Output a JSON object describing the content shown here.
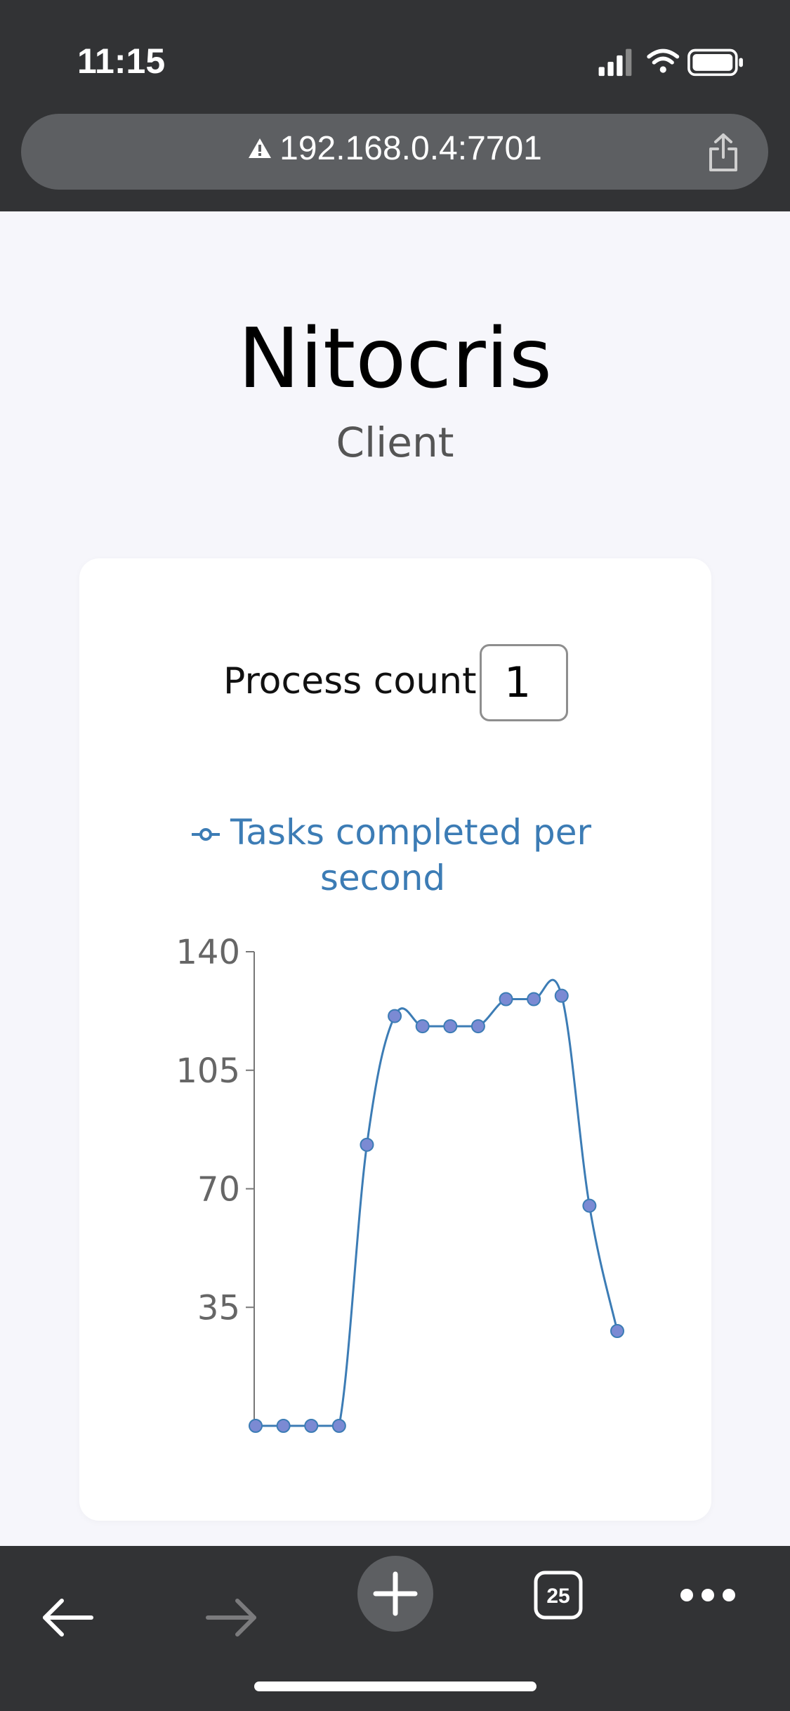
{
  "status_bar": {
    "time": "11:15"
  },
  "browser": {
    "url": "192.168.0.4:7701",
    "tab_count": "25"
  },
  "app": {
    "title": "Nitocris",
    "subtitle": "Client"
  },
  "controls": {
    "process_count_label": "Process count",
    "process_count_value": "1"
  },
  "colors": {
    "series": "#3c7cb5",
    "point_fill": "#7b8ad3",
    "topbar": "#323335"
  },
  "chart_data": {
    "type": "line",
    "legend": [
      "Tasks completed per",
      "second"
    ],
    "series": [
      {
        "name": "Tasks completed per second",
        "values": [
          0,
          0,
          0,
          0,
          83,
          121,
          118,
          118,
          118,
          126,
          126,
          127,
          65,
          28
        ]
      }
    ],
    "ylim": [
      0,
      140
    ],
    "yticks": [
      "140",
      "105",
      "70",
      "35"
    ],
    "grid": false,
    "legend_position": "top"
  }
}
